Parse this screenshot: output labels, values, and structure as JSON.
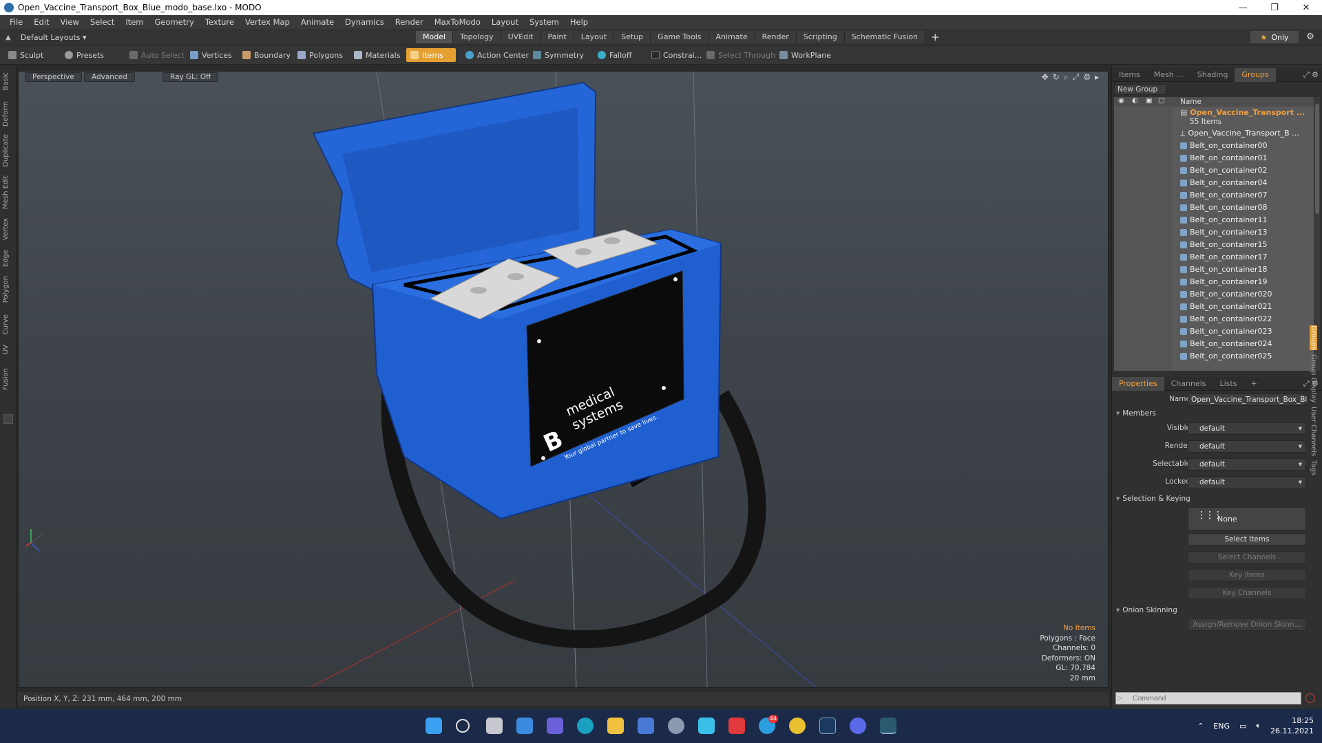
{
  "window": {
    "title": "Open_Vaccine_Transport_Box_Blue_modo_base.lxo - MODO",
    "controls": [
      "—",
      "❐",
      "✕"
    ]
  },
  "menu": [
    "File",
    "Edit",
    "View",
    "Select",
    "Item",
    "Geometry",
    "Texture",
    "Vertex Map",
    "Animate",
    "Dynamics",
    "Render",
    "MaxToModo",
    "Layout",
    "System",
    "Help"
  ],
  "layoutbar": {
    "layouts_label": "Default Layouts",
    "tabs": [
      "Model",
      "Topology",
      "UVEdit",
      "Paint",
      "Layout",
      "Setup",
      "Game Tools",
      "Animate",
      "Render",
      "Scripting",
      "Schematic Fusion"
    ],
    "active_tab": "Model",
    "only_label": "Only"
  },
  "toolbar": {
    "sculpt": "Sculpt",
    "presets": "Presets",
    "auto_select": "Auto Select",
    "vertices": "Vertices",
    "boundary": "Boundary",
    "polygons": "Polygons",
    "materials": "Materials",
    "items": "Items",
    "action_center": "Action Center",
    "symmetry": "Symmetry",
    "falloff": "Falloff",
    "constrain": "Constrai...",
    "select_through": "Select Through",
    "workplane": "WorkPlane"
  },
  "left_tabs": [
    "Basic",
    "Deform",
    "Duplicate",
    "Mesh Edit",
    "Vertex",
    "Edge",
    "Polygon",
    "Curve",
    "UV",
    "Fusion"
  ],
  "viewport": {
    "perspective": "Perspective",
    "advanced": "Advanced",
    "raygl": "Ray GL: Off",
    "info": {
      "no_items": "No Items",
      "polygons": "Polygons : Face",
      "channels": "Channels: 0",
      "deformers": "Deformers: ON",
      "gl": "GL: 70,784",
      "scale": "20 mm"
    },
    "brand": {
      "letter": "B",
      "line1": "medical",
      "line2": "systems",
      "tagline": "Your global partner to save lives."
    },
    "colors": {
      "box": "#1f5fd0",
      "lid": "#2466d8",
      "panel": "#0b0b0c",
      "ice": "#d8d8d8",
      "strap": "#141414"
    }
  },
  "status": {
    "position": "Position X, Y, Z:   231 mm, 464 mm, 200 mm"
  },
  "groups_panel": {
    "tabs": [
      "Items",
      "Mesh ...",
      "Shading",
      "Groups"
    ],
    "active_tab": "Groups",
    "new_group": "New Group",
    "name_header": "Name",
    "group_name": "Open_Vaccine_Transport ...",
    "item_count": "55 Items",
    "items": [
      "Open_Vaccine_Transport_B ...",
      "Belt_on_container00",
      "Belt_on_container01",
      "Belt_on_container02",
      "Belt_on_container04",
      "Belt_on_container07",
      "Belt_on_container08",
      "Belt_on_container11",
      "Belt_on_container13",
      "Belt_on_container15",
      "Belt_on_container17",
      "Belt_on_container18",
      "Belt_on_container19",
      "Belt_on_container020",
      "Belt_on_container021",
      "Belt_on_container022",
      "Belt_on_container023",
      "Belt_on_container024",
      "Belt_on_container025"
    ]
  },
  "properties_panel": {
    "tabs": [
      "Properties",
      "Channels",
      "Lists"
    ],
    "active_tab": "Properties",
    "name_label": "Name",
    "name_value": "Open_Vaccine_Transport_Box_Bl",
    "members_section": "Members",
    "visible_label": "Visible",
    "render_label": "Render",
    "selectable_label": "Selectable",
    "locked_label": "Locked",
    "default_value": "default",
    "selection_section": "Selection & Keying",
    "none_label": "None",
    "select_items": "Select Items",
    "select_channels": "Select Channels",
    "key_items": "Key Items",
    "key_channels": "Key Channels",
    "onion_section": "Onion Skinning",
    "assign_onion": "Assign/Remove Onion Skinn...",
    "right_vtabs": [
      "Groups",
      "Group Display",
      "User Channels",
      "Tags"
    ]
  },
  "command": {
    "placeholder": "Command",
    "prompt": ">"
  },
  "taskbar": {
    "badge": "44",
    "lang": "ENG",
    "time": "18:25",
    "date": "26.11.2021"
  }
}
